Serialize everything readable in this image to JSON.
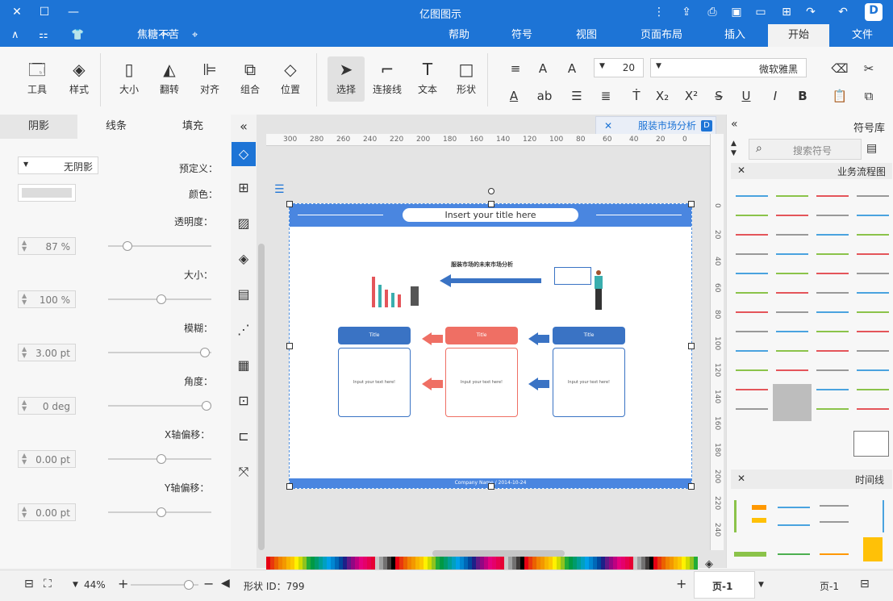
{
  "app": {
    "title": "亿图图示",
    "logo": "D"
  },
  "menu": {
    "tabs": [
      "文件",
      "开始",
      "插入",
      "页面布局",
      "视图",
      "符号",
      "帮助"
    ],
    "active": "开始",
    "user": "焦糖不苦"
  },
  "ribbon": {
    "font_name": "微软雅黑",
    "font_size": "20",
    "big_buttons": [
      {
        "label": "选择"
      },
      {
        "label": "连接线"
      },
      {
        "label": "文本"
      },
      {
        "label": "形状"
      },
      {
        "label": "位置"
      },
      {
        "label": "组合"
      },
      {
        "label": "对齐"
      },
      {
        "label": "翻转"
      },
      {
        "label": "大小"
      },
      {
        "label": "样式"
      },
      {
        "label": "工具"
      }
    ]
  },
  "props": {
    "tabs": [
      "填充",
      "线条",
      "阴影"
    ],
    "active_tab": "阴影",
    "preset_label": "预定义：",
    "preset_value": "无阴影",
    "color_label": "颜色：",
    "rows": [
      {
        "label": "透明度：",
        "value": "87 %",
        "level": 0.15
      },
      {
        "label": "大小：",
        "value": "100 %",
        "level": 0.5
      },
      {
        "label": "模糊：",
        "value": "3.00 pt",
        "level": 0.95
      },
      {
        "label": "角度：",
        "value": "0 deg",
        "level": 0.97
      },
      {
        "label": "X轴偏移：",
        "value": "0.00 pt",
        "level": 0.5
      },
      {
        "label": "Y轴偏移：",
        "value": "0.00 pt",
        "level": 0.5
      }
    ]
  },
  "document": {
    "tab_title": "服装市场分析",
    "ruler_top": [
      "0",
      "20",
      "40",
      "60",
      "80",
      "100",
      "120",
      "140",
      "160",
      "180",
      "200",
      "220",
      "240",
      "260",
      "280",
      "300"
    ],
    "ruler_right": [
      "0",
      "20",
      "40",
      "60",
      "80",
      "100",
      "120",
      "140",
      "160",
      "180",
      "200",
      "220",
      "240"
    ],
    "page_title": "Insert your title here",
    "subtitle": "服装市场的未来市场分析",
    "cards": [
      {
        "title": "Title",
        "body": "Input your text here!",
        "color": "#3a73c4"
      },
      {
        "title": "Title",
        "body": "Input your text here!",
        "color": "#ef6f64"
      },
      {
        "title": "Title",
        "body": "Input your text here!",
        "color": "#3a73c4"
      }
    ],
    "footer": "Company Name / 2014-10-24"
  },
  "library": {
    "title": "符号库",
    "search_placeholder": "搜索符号",
    "section1": "业务流程图",
    "section2": "时间线"
  },
  "status": {
    "page_label": "页-1",
    "page_tab": "页-1",
    "shape_id": "形状 ID：799",
    "zoom": "44%"
  },
  "palette": [
    "#e60012",
    "#e8380d",
    "#eb6100",
    "#f08300",
    "#f39800",
    "#f8b500",
    "#fcc800",
    "#fff100",
    "#cfdb00",
    "#8fc31f",
    "#22ac38",
    "#009944",
    "#009b6b",
    "#009e96",
    "#00a0c1",
    "#00a0e9",
    "#0086d1",
    "#0068b7",
    "#00479d",
    "#1d2088",
    "#601986",
    "#920783",
    "#be0081",
    "#e4007f",
    "#e5006a",
    "#e5004f",
    "#e60033",
    "#c9c9c9",
    "#9fa0a0",
    "#727171",
    "#3e3a39",
    "#000000"
  ],
  "colors": {
    "accent": "#1d74d6",
    "red": "#ef6f64",
    "blue": "#3a73c4"
  }
}
